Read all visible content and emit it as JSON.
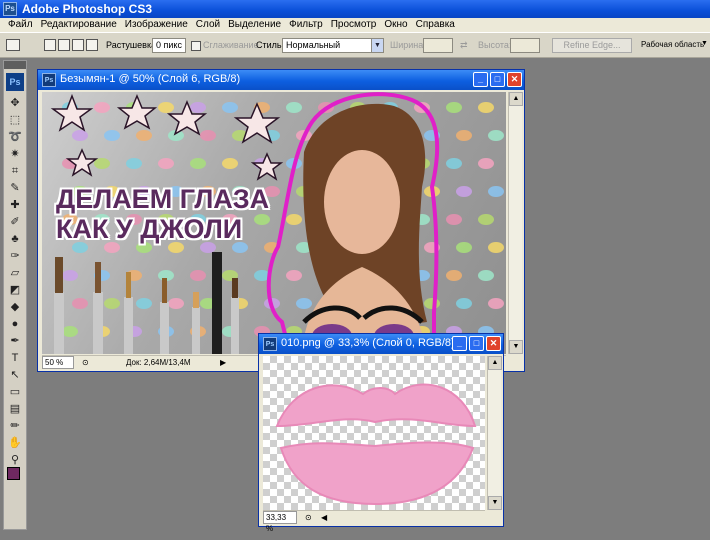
{
  "app": {
    "title": "Adobe Photoshop CS3",
    "icon_text": "Ps"
  },
  "menu": [
    "Файл",
    "Редактирование",
    "Изображение",
    "Слой",
    "Выделение",
    "Фильтр",
    "Просмотр",
    "Окно",
    "Справка"
  ],
  "options": {
    "feather_label": "Растушевка:",
    "feather_value": "0 пикс",
    "antialias_label": "Сглаживание",
    "style_label": "Стиль:",
    "style_value": "Нормальный",
    "width_label": "Ширина:",
    "height_label": "Высота:",
    "refine_edge": "Refine Edge...",
    "workspace": "Рабочая область"
  },
  "toolbox": {
    "logo": "Ps",
    "tools": [
      {
        "name": "move-tool-icon",
        "glyph": "✥"
      },
      {
        "name": "marquee-tool-icon",
        "glyph": "⬚"
      },
      {
        "name": "lasso-tool-icon",
        "glyph": "➰"
      },
      {
        "name": "magic-wand-tool-icon",
        "glyph": "✷"
      },
      {
        "name": "crop-tool-icon",
        "glyph": "⌗"
      },
      {
        "name": "slice-tool-icon",
        "glyph": "✎"
      },
      {
        "name": "healing-brush-tool-icon",
        "glyph": "✚"
      },
      {
        "name": "brush-tool-icon",
        "glyph": "✐"
      },
      {
        "name": "clone-stamp-tool-icon",
        "glyph": "♣"
      },
      {
        "name": "history-brush-tool-icon",
        "glyph": "✑"
      },
      {
        "name": "eraser-tool-icon",
        "glyph": "▱"
      },
      {
        "name": "gradient-tool-icon",
        "glyph": "◩"
      },
      {
        "name": "blur-tool-icon",
        "glyph": "◆"
      },
      {
        "name": "dodge-tool-icon",
        "glyph": "●"
      },
      {
        "name": "pen-tool-icon",
        "glyph": "✒"
      },
      {
        "name": "type-tool-icon",
        "glyph": "T"
      },
      {
        "name": "path-selection-tool-icon",
        "glyph": "↖"
      },
      {
        "name": "shape-tool-icon",
        "glyph": "▭"
      },
      {
        "name": "notes-tool-icon",
        "glyph": "▤"
      },
      {
        "name": "eyedropper-tool-icon",
        "glyph": "✏"
      },
      {
        "name": "hand-tool-icon",
        "glyph": "✋"
      },
      {
        "name": "zoom-tool-icon",
        "glyph": "⚲"
      }
    ],
    "foreground_color": "#6e2860",
    "background_color": "#ffffff"
  },
  "doc1": {
    "title": "Безымян-1 @ 50% (Слой 6, RGB/8)",
    "headline_line1": "ДЕЛАЕМ ГЛАЗА",
    "headline_line2": "КАК У ДЖОЛИ",
    "zoom": "50 %",
    "doc_size": "Док: 2,64M/13,4M"
  },
  "doc2": {
    "title": "010.png @ 33,3% (Слой 0, RGB/8)",
    "zoom": "33,33 %"
  },
  "colors": {
    "accent_magenta": "#e020c8",
    "headline": "#5a2a5e",
    "lips": "#f0a2c9"
  }
}
